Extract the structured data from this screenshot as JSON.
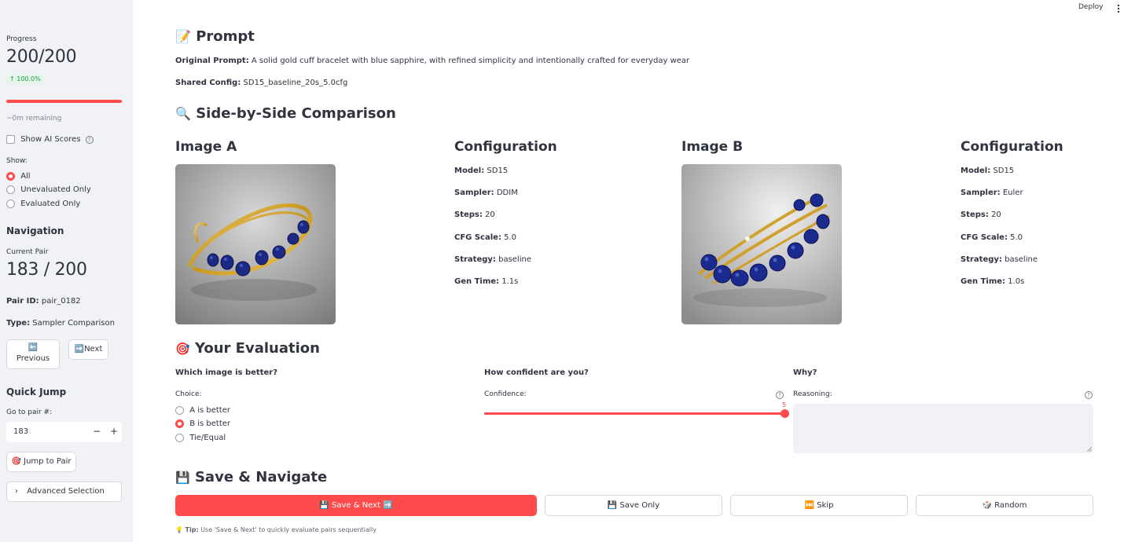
{
  "header": {
    "deploy_label": "Deploy",
    "menu_icon": "kebab-menu-icon"
  },
  "sidebar": {
    "progress": {
      "label": "Progress",
      "value": "200/200",
      "delta": "↑ 100.0%",
      "fraction": 1.0,
      "remaining": "~0m remaining"
    },
    "show_ai_scores": {
      "label": "Show AI Scores",
      "checked": false
    },
    "filter": {
      "label": "Show:",
      "options": [
        "All",
        "Unevaluated Only",
        "Evaluated Only"
      ],
      "selected": "All"
    },
    "navigation": {
      "title": "Navigation",
      "current_pair_label": "Current Pair",
      "current_pair_value": "183 / 200",
      "pair_id_label": "Pair ID:",
      "pair_id_value": "pair_0182",
      "type_label": "Type:",
      "type_value": "Sampler Comparison",
      "previous_label": "Previous",
      "previous_icon": "⬅️",
      "next_label": "Next",
      "next_icon": "➡️"
    },
    "quick_jump": {
      "title": "Quick Jump",
      "input_label": "Go to pair #:",
      "input_value": "183",
      "minus": "−",
      "plus": "+",
      "jump_label": "Jump to Pair",
      "jump_icon": "🎯",
      "advanced_label": "Advanced Selection"
    }
  },
  "prompt": {
    "icon": "📝",
    "title": "Prompt",
    "original_label": "Original Prompt:",
    "original_value": "A solid gold cuff bracelet with blue sapphire, with refined simplicity and intentionally crafted for everyday wear",
    "config_label": "Shared Config:",
    "config_value": "SD15_baseline_20s_5.0cfg"
  },
  "comparison": {
    "icon": "🔍",
    "title": "Side-by-Side Comparison",
    "image_a": {
      "title": "Image A",
      "config_title": "Configuration",
      "config": [
        {
          "k": "Model:",
          "v": "SD15"
        },
        {
          "k": "Sampler:",
          "v": "DDIM"
        },
        {
          "k": "Steps:",
          "v": "20"
        },
        {
          "k": "CFG Scale:",
          "v": "5.0"
        },
        {
          "k": "Strategy:",
          "v": "baseline"
        },
        {
          "k": "Gen Time:",
          "v": "1.1s"
        }
      ]
    },
    "image_b": {
      "title": "Image B",
      "config_title": "Configuration",
      "config": [
        {
          "k": "Model:",
          "v": "SD15"
        },
        {
          "k": "Sampler:",
          "v": "Euler"
        },
        {
          "k": "Steps:",
          "v": "20"
        },
        {
          "k": "CFG Scale:",
          "v": "5.0"
        },
        {
          "k": "Strategy:",
          "v": "baseline"
        },
        {
          "k": "Gen Time:",
          "v": "1.0s"
        }
      ]
    }
  },
  "evaluation": {
    "icon": "🎯",
    "title": "Your Evaluation",
    "choice": {
      "heading": "Which image is better?",
      "label": "Choice:",
      "options": [
        "A is better",
        "B is better",
        "Tie/Equal"
      ],
      "selected": "B is better"
    },
    "confidence": {
      "heading": "How confident are you?",
      "label": "Confidence:",
      "value": "5",
      "level": 1.0
    },
    "why": {
      "heading": "Why?",
      "label": "Reasoning:",
      "value": ""
    }
  },
  "save": {
    "icon": "💾",
    "title": "Save & Navigate",
    "save_next": "💾 Save & Next ➡️",
    "save_only": "💾 Save Only",
    "skip": "⏭️ Skip",
    "random": "🎲 Random",
    "tip_icon": "💡",
    "tip_label": "Tip:",
    "tip_text": "Use 'Save & Next' to quickly evaluate pairs sequentially"
  },
  "colors": {
    "accent": "#ff4b4b",
    "sidebar_bg": "#f0f2f6",
    "delta_green": "#21a048"
  }
}
